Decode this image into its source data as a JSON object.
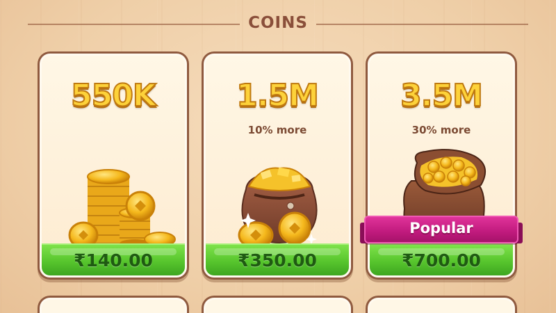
{
  "section": {
    "title": "COINS"
  },
  "offers": [
    {
      "amount": "550K",
      "bonus": "",
      "price": "₹140.00",
      "art_icon": "coin-stack-icon"
    },
    {
      "amount": "1.5M",
      "bonus": "10% more",
      "price": "₹350.00",
      "art_icon": "coin-bag-icon"
    },
    {
      "amount": "3.5M",
      "bonus": "30% more",
      "price": "₹700.00",
      "art_icon": "coin-sack-icon",
      "badge": "Popular"
    }
  ],
  "colors": {
    "coin_gold": "#fdd23a",
    "price_green": "#57c52d",
    "badge_pink": "#c01a7d",
    "card_border": "#8f5a3f"
  }
}
